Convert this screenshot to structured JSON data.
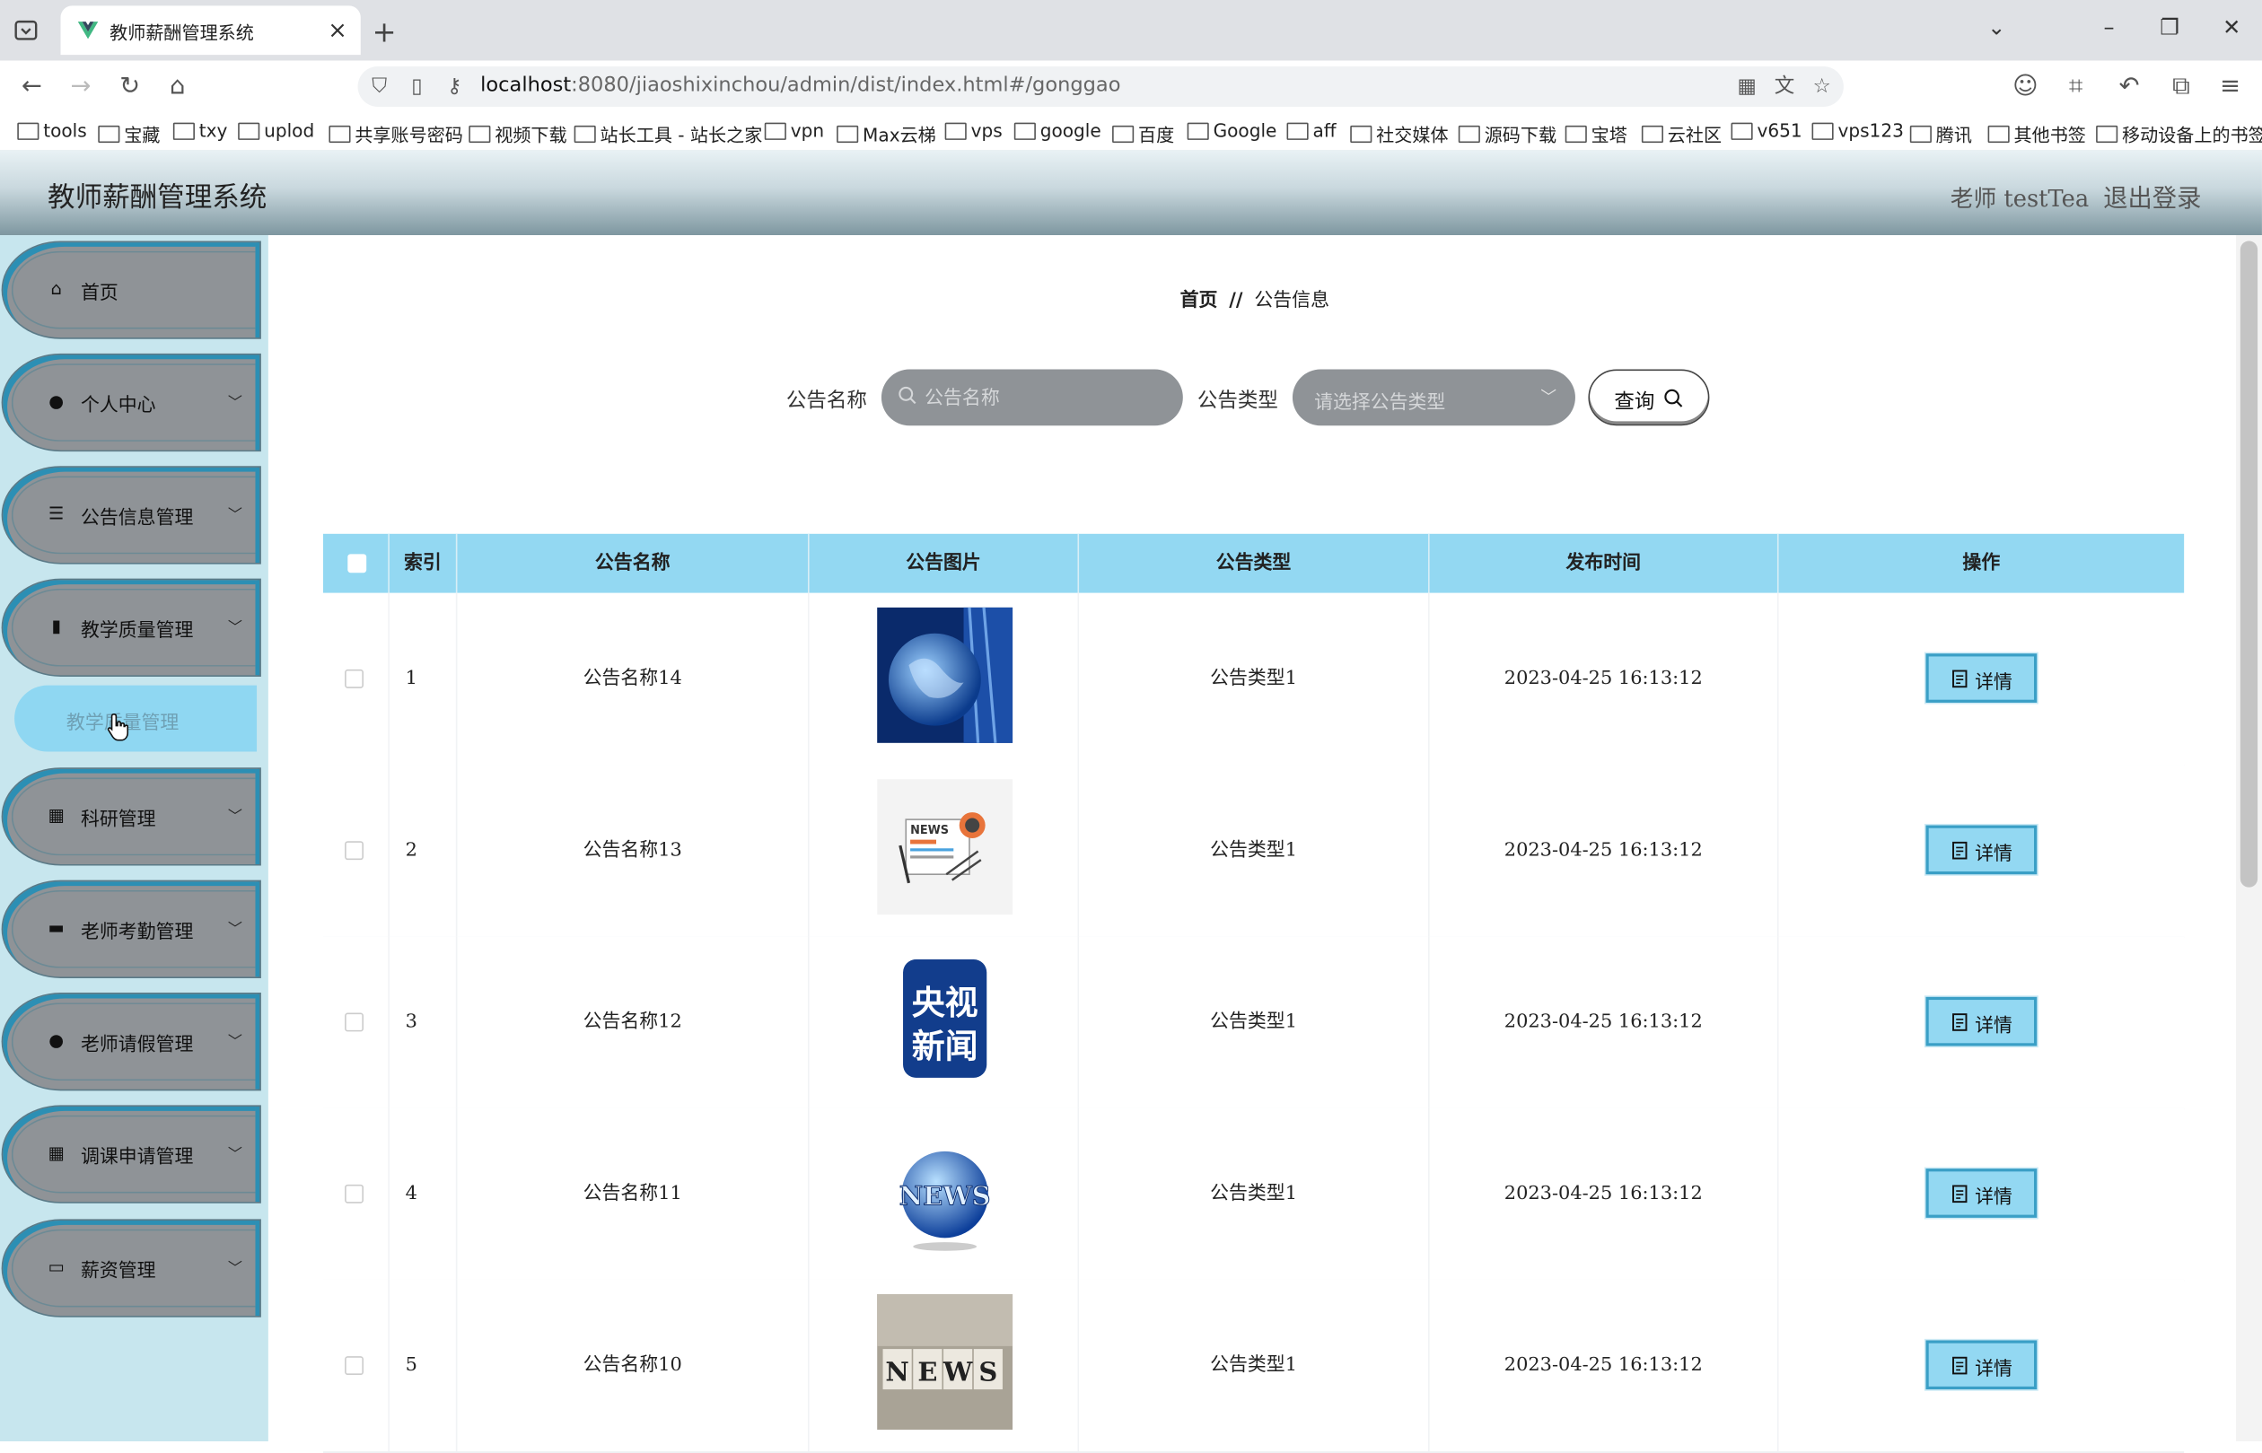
{
  "browser": {
    "tab_title": "教师薪酬管理系统",
    "url_host": "localhost",
    "url_rest": ":8080/jiaoshixinchou/admin/dist/index.html#/gonggao",
    "bookmarks": [
      "tools",
      "宝藏",
      "txy",
      "uplod",
      "共享账号密码",
      "视频下载",
      "站长工具 - 站长之家",
      "vpn",
      "Max云梯",
      "vps",
      "google",
      "百度",
      "Google",
      "aff",
      "社交媒体",
      "源码下载",
      "宝塔",
      "云社区",
      "v651",
      "vps123",
      "腾讯",
      "其他书签",
      "移动设备上的书签"
    ]
  },
  "header": {
    "title": "教师薪酬管理系统",
    "user": "老师 testTea",
    "logout": "退出登录"
  },
  "sidebar": {
    "items": [
      {
        "label": "首页",
        "icon": "home-icon"
      },
      {
        "label": "个人中心",
        "icon": "user-icon"
      },
      {
        "label": "公告信息管理",
        "icon": "list-icon"
      },
      {
        "label": "教学质量管理",
        "icon": "bar-chart-icon"
      },
      {
        "label": "科研管理",
        "icon": "grid-icon"
      },
      {
        "label": "老师考勤管理",
        "icon": "briefcase-icon"
      },
      {
        "label": "老师请假管理",
        "icon": "user-icon"
      },
      {
        "label": "调课申请管理",
        "icon": "grid-icon"
      },
      {
        "label": "薪资管理",
        "icon": "monitor-icon"
      }
    ],
    "submenu": {
      "label": "教学质量管理"
    }
  },
  "breadcrumb": {
    "home": "首页",
    "sep": "//",
    "current": "公告信息"
  },
  "search": {
    "name_label": "公告名称",
    "name_placeholder": "公告名称",
    "type_label": "公告类型",
    "type_placeholder": "请选择公告类型",
    "query_label": "查询"
  },
  "table": {
    "columns": [
      "索引",
      "公告名称",
      "公告图片",
      "公告类型",
      "发布时间",
      "操作"
    ],
    "detail_label": "详情",
    "rows": [
      {
        "index": "1",
        "name": "公告名称14",
        "image": "globe-news-image",
        "type": "公告类型1",
        "time": "2023-04-25 16:13:12"
      },
      {
        "index": "2",
        "name": "公告名称13",
        "image": "newspaper-image",
        "type": "公告类型1",
        "time": "2023-04-25 16:13:12"
      },
      {
        "index": "3",
        "name": "公告名称12",
        "image": "cctv-news-logo-image",
        "type": "公告类型1",
        "time": "2023-04-25 16:13:12"
      },
      {
        "index": "4",
        "name": "公告名称11",
        "image": "news-globe-image",
        "type": "公告类型1",
        "time": "2023-04-25 16:13:12"
      },
      {
        "index": "5",
        "name": "公告名称10",
        "image": "news-blocks-image",
        "type": "公告类型1",
        "time": "2023-04-25 16:13:12"
      }
    ]
  },
  "logo_text": {
    "newspaper": "NEWS",
    "cctv_top": "央视",
    "cctv_bottom": "新闻",
    "globe": "NEWS",
    "blocks": [
      "N",
      "E",
      "W",
      "S"
    ]
  },
  "colors": {
    "accent": "#93d8f2",
    "sidebar_bg": "#c7e6ee",
    "menu_item": "#8f9397",
    "menu_border": "#2c8fb4"
  }
}
